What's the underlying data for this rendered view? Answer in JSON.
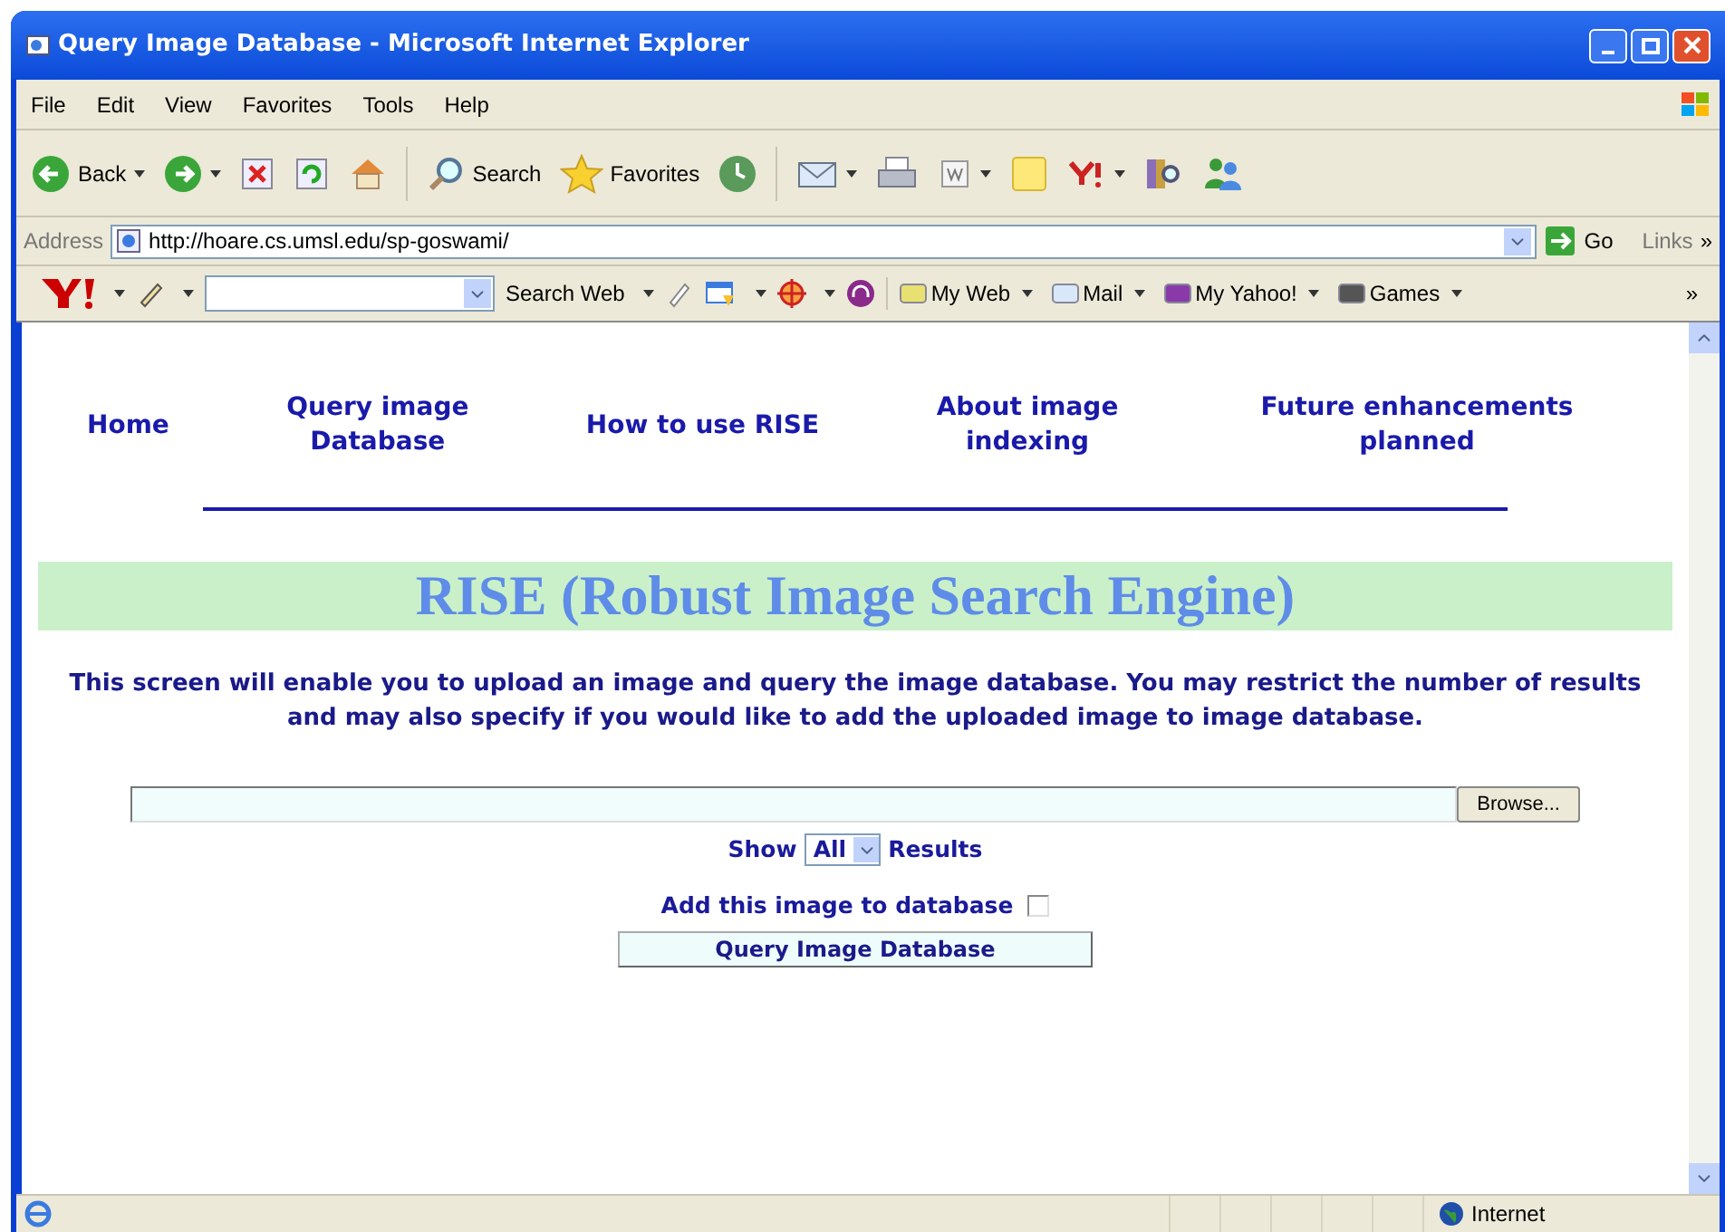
{
  "window": {
    "title": "Query Image Database - Microsoft Internet Explorer"
  },
  "menu": [
    "File",
    "Edit",
    "View",
    "Favorites",
    "Tools",
    "Help"
  ],
  "toolbar": {
    "back": "Back",
    "search": "Search",
    "favorites": "Favorites"
  },
  "address_bar": {
    "label": "Address",
    "url": "http://hoare.cs.umsl.edu/sp-goswami/",
    "go": "Go",
    "links": "Links",
    "more": "»"
  },
  "yahoo_bar": {
    "search_button": "Search Web",
    "items": [
      "My Web",
      "Mail",
      "My Yahoo!",
      "Games"
    ],
    "more": "»"
  },
  "nav": [
    {
      "label": "Home"
    },
    {
      "label": "Query image Database"
    },
    {
      "label": "How to use RISE"
    },
    {
      "label": "About image indexing"
    },
    {
      "label": "Future enhancements planned"
    }
  ],
  "heading": "RISE (Robust Image Search Engine)",
  "description": "This screen will enable you to upload an image and query the image database. You may restrict the number of results and may also specify if you would like to add the uploaded image to image database.",
  "form": {
    "browse": "Browse...",
    "show_label": "Show",
    "show_value": "All",
    "results_label": "Results",
    "add_label": "Add this image to database",
    "add_checked": false,
    "submit": "Query Image Database"
  },
  "status_bar": {
    "zone": "Internet"
  }
}
